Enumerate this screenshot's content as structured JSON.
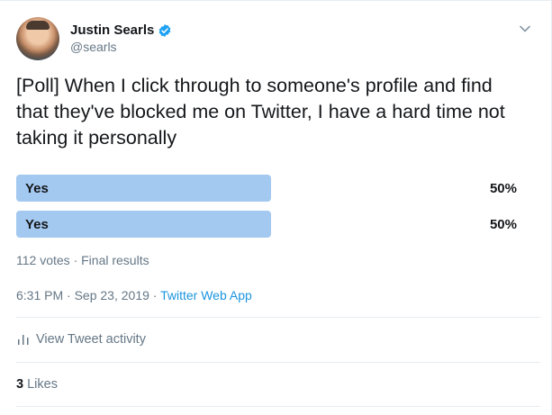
{
  "user": {
    "name": "Justin Searls",
    "handle": "@searls"
  },
  "tweet_text": "[Poll] When I click through to someone's profile and find that they've blocked me on Twitter, I have a hard time not taking it personally",
  "poll": {
    "options": [
      {
        "label": "Yes",
        "percent_text": "50%",
        "percent": 50
      },
      {
        "label": "Yes",
        "percent_text": "50%",
        "percent": 50
      }
    ],
    "votes": "112 votes",
    "separator": "·",
    "status": "Final results"
  },
  "timestamp": {
    "time": "6:31 PM",
    "date": "Sep 23, 2019",
    "source": "Twitter Web App"
  },
  "activity_label": "View Tweet activity",
  "likes": {
    "count": "3",
    "label": "Likes"
  },
  "colors": {
    "poll_bar": "#a4c9f0",
    "link": "#1b95e0",
    "verified": "#1da1f2"
  },
  "icons": [
    "verified-badge-icon",
    "chevron-down-icon",
    "bar-chart-icon"
  ]
}
